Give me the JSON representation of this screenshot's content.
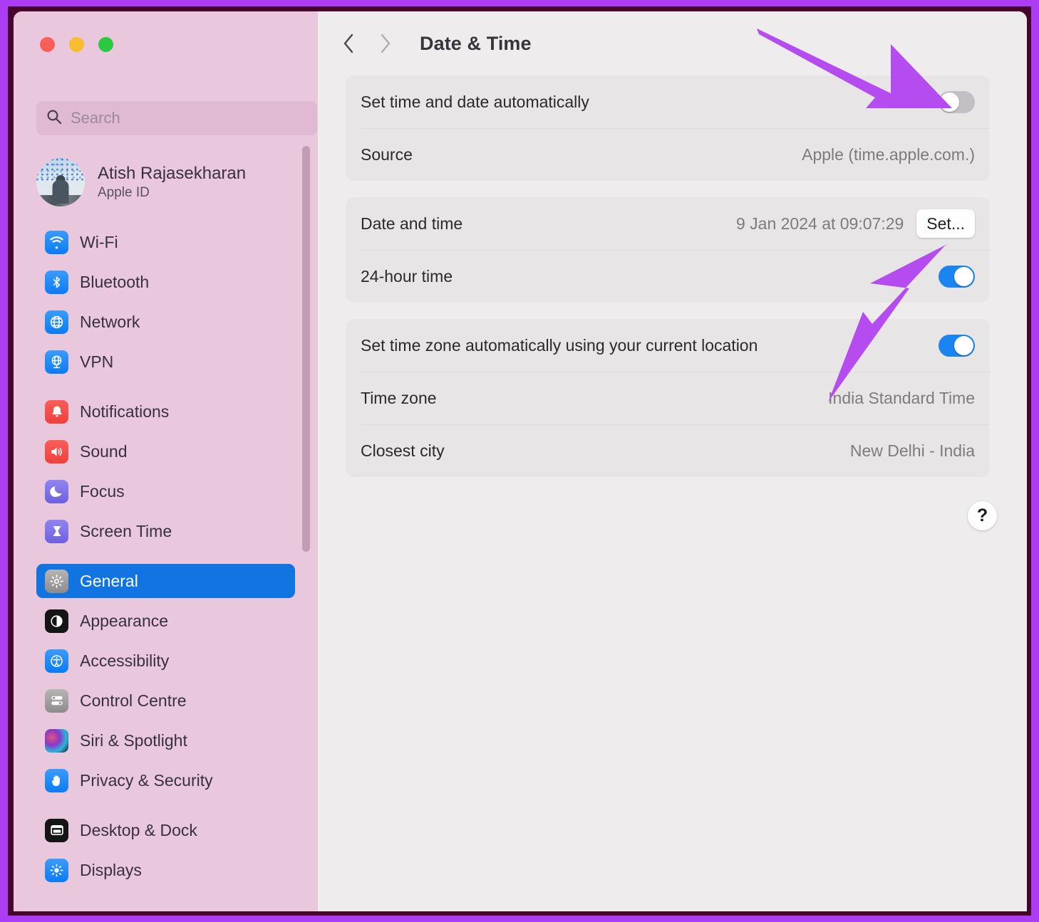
{
  "window": {
    "traffic_lights": [
      "close",
      "minimize",
      "zoom"
    ],
    "frame_accent_color": "#ad3cf5",
    "frame_color": "#45052c"
  },
  "sidebar": {
    "background_color": "#e9c8de",
    "search": {
      "placeholder": "Search",
      "value": "",
      "icon": "search-icon"
    },
    "account": {
      "name": "Atish Rajasekharan",
      "subtitle": "Apple ID",
      "avatar": "user-avatar"
    },
    "groups": [
      {
        "items": [
          {
            "label": "Wi-Fi",
            "icon": "wifi-icon",
            "selected": false
          },
          {
            "label": "Bluetooth",
            "icon": "bluetooth-icon",
            "selected": false
          },
          {
            "label": "Network",
            "icon": "network-icon",
            "selected": false
          },
          {
            "label": "VPN",
            "icon": "vpn-icon",
            "selected": false
          }
        ]
      },
      {
        "items": [
          {
            "label": "Notifications",
            "icon": "bell-icon",
            "selected": false
          },
          {
            "label": "Sound",
            "icon": "speaker-icon",
            "selected": false
          },
          {
            "label": "Focus",
            "icon": "moon-icon",
            "selected": false
          },
          {
            "label": "Screen Time",
            "icon": "hourglass-icon",
            "selected": false
          }
        ]
      },
      {
        "items": [
          {
            "label": "General",
            "icon": "gear-icon",
            "selected": true
          },
          {
            "label": "Appearance",
            "icon": "appearance-icon",
            "selected": false
          },
          {
            "label": "Accessibility",
            "icon": "accessibility-icon",
            "selected": false
          },
          {
            "label": "Control Centre",
            "icon": "sliders-icon",
            "selected": false
          },
          {
            "label": "Siri & Spotlight",
            "icon": "siri-icon",
            "selected": false
          },
          {
            "label": "Privacy & Security",
            "icon": "hand-icon",
            "selected": false
          }
        ]
      },
      {
        "items": [
          {
            "label": "Desktop & Dock",
            "icon": "desktop-dock-icon",
            "selected": false
          },
          {
            "label": "Displays",
            "icon": "brightness-icon",
            "selected": false
          }
        ]
      }
    ],
    "selected_accent_color": "#1274e0"
  },
  "toolbar": {
    "back_icon": "chevron-left-icon",
    "forward_icon": "chevron-right-icon",
    "title": "Date & Time"
  },
  "main": {
    "cards": [
      {
        "rows": [
          {
            "label": "Set time and date automatically",
            "control": "toggle",
            "toggle_state": "off",
            "value": ""
          },
          {
            "label": "Source",
            "control": "value",
            "value": "Apple (time.apple.com.)"
          }
        ]
      },
      {
        "rows": [
          {
            "label": "Date and time",
            "control": "value-button",
            "value": "9 Jan 2024 at 09:07:29",
            "button_label": "Set..."
          },
          {
            "label": "24-hour time",
            "control": "toggle",
            "toggle_state": "on",
            "value": ""
          }
        ]
      },
      {
        "rows": [
          {
            "label": "Set time zone automatically using your current location",
            "control": "toggle",
            "toggle_state": "on",
            "value": ""
          },
          {
            "label": "Time zone",
            "control": "value",
            "value": "India Standard Time"
          },
          {
            "label": "Closest city",
            "control": "value",
            "value": "New Delhi - India"
          }
        ]
      }
    ],
    "help_button_label": "?",
    "toggle_on_color": "#1a84f0",
    "toggle_off_color": "#c4bfc4"
  },
  "annotations": {
    "arrow_color": "#b44cf0",
    "arrows": [
      {
        "name": "arrow-to-auto-time-toggle",
        "points_to": "Set time and date automatically toggle"
      },
      {
        "name": "arrow-to-set-button",
        "points_to": "Set... button"
      }
    ]
  }
}
